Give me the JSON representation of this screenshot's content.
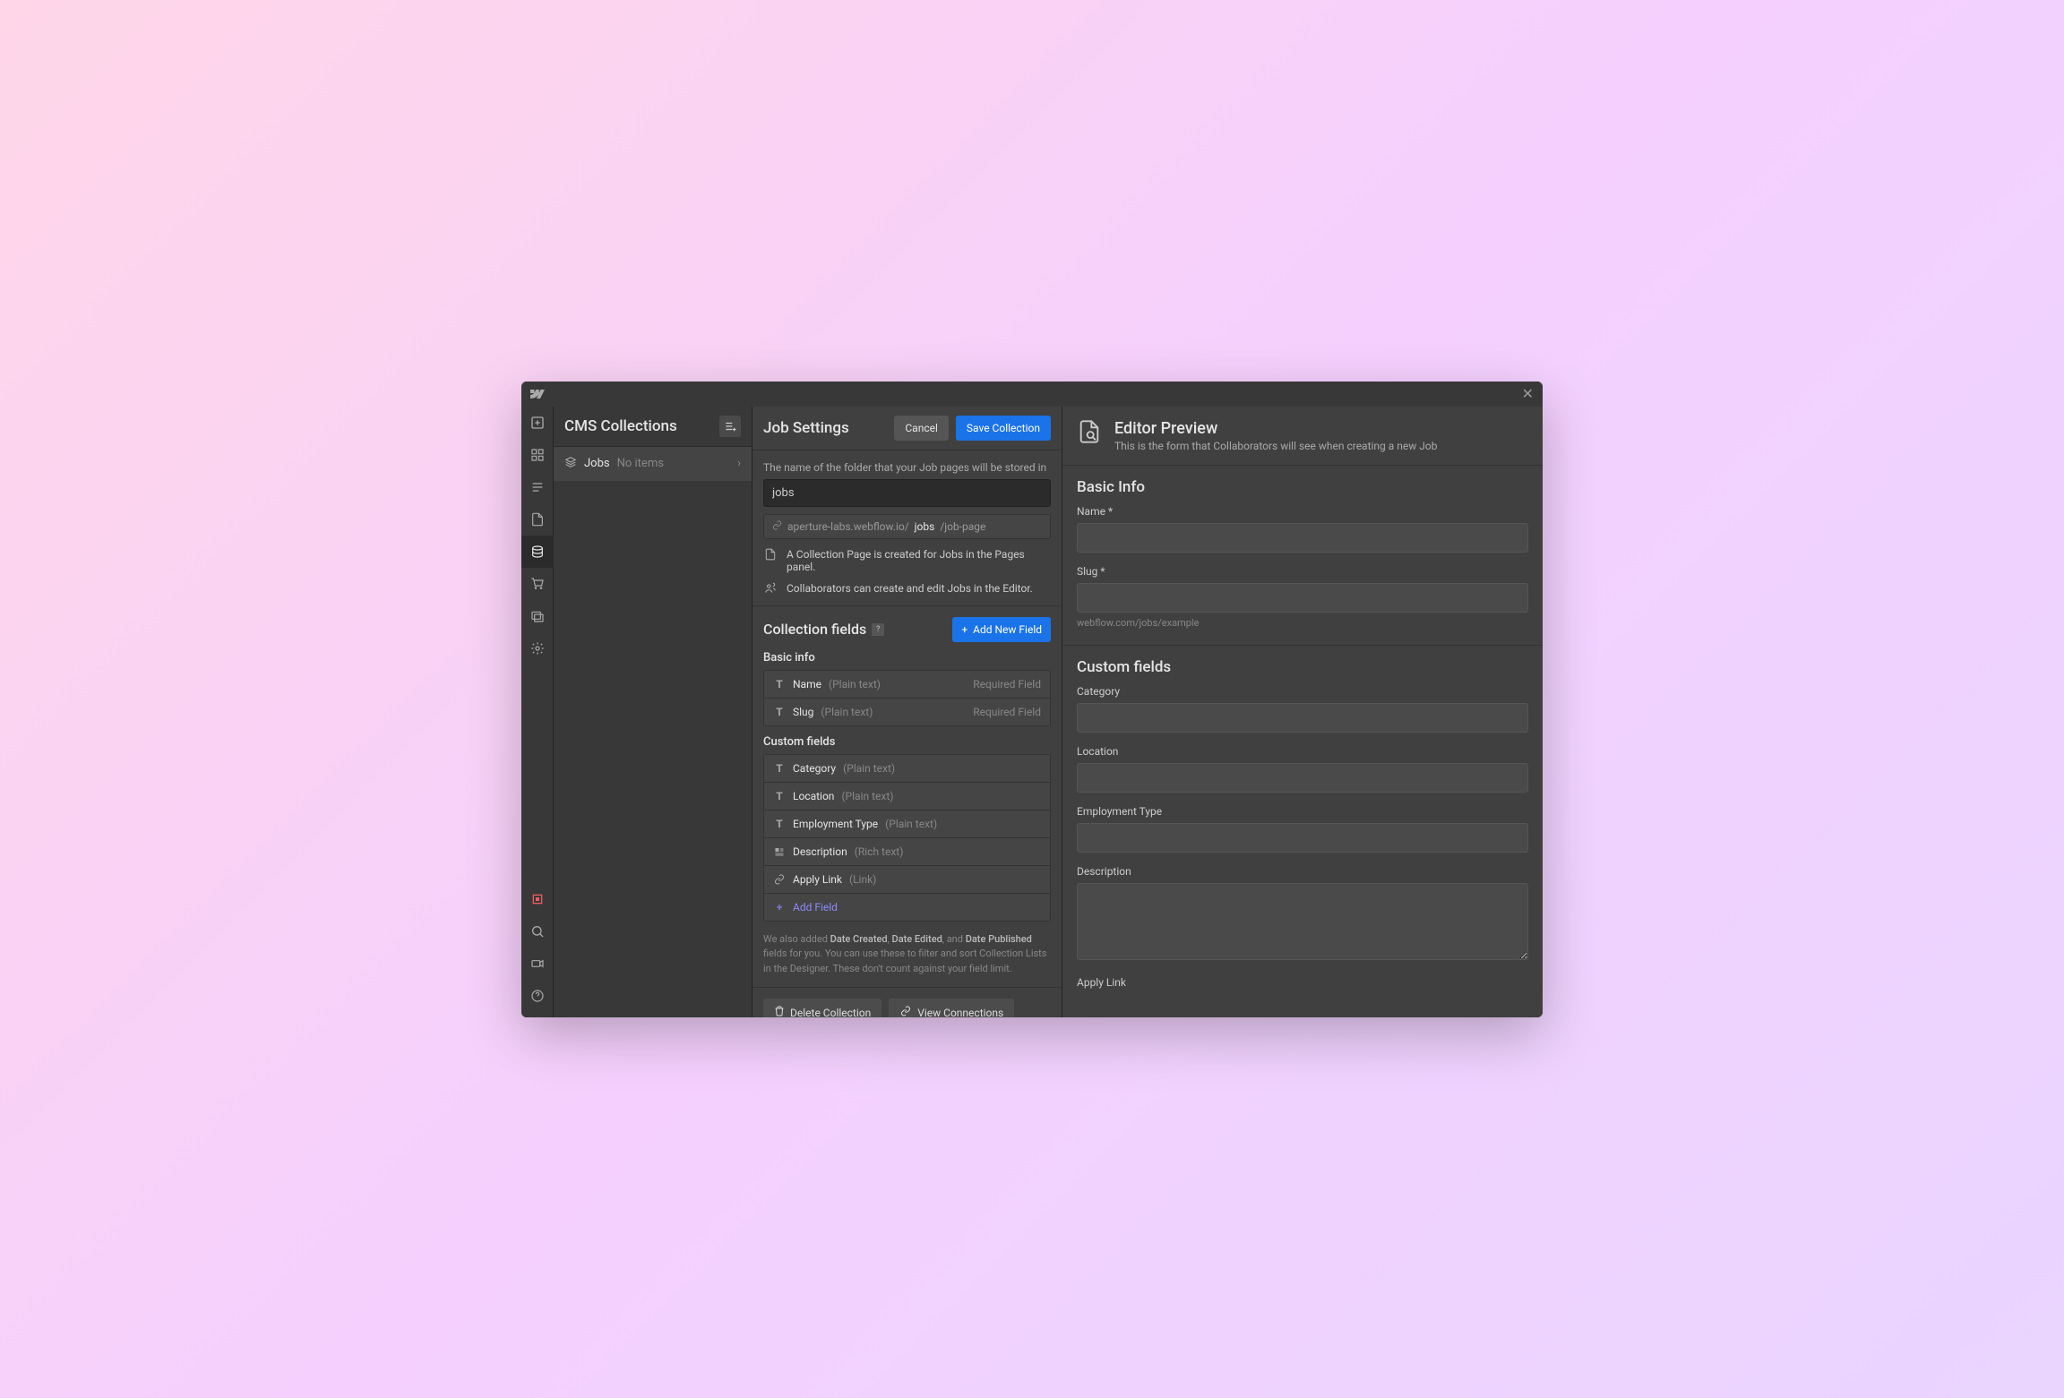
{
  "sidebar": {
    "title": "CMS Collections",
    "items": [
      {
        "name": "Jobs",
        "meta": "No items"
      }
    ]
  },
  "settings": {
    "title": "Job Settings",
    "cancel_label": "Cancel",
    "save_label": "Save Collection",
    "folder_label": "The name of the folder that your Job pages will be stored in",
    "slug_value": "jobs",
    "url_prefix": "aperture-labs.webflow.io/",
    "url_slug": "jobs",
    "url_suffix": "/job-page",
    "info1": "A Collection Page is created for Jobs in the Pages panel.",
    "info2": "Collaborators can create and edit Jobs in the Editor.",
    "collection_fields_title": "Collection fields",
    "add_new_field_label": "Add New Field",
    "basic_info_label": "Basic info",
    "basic_fields": [
      {
        "name": "Name",
        "type": "(Plain text)",
        "required": "Required Field"
      },
      {
        "name": "Slug",
        "type": "(Plain text)",
        "required": "Required Field"
      }
    ],
    "custom_fields_label": "Custom fields",
    "custom_fields": [
      {
        "name": "Category",
        "type": "(Plain text)",
        "icon": "T"
      },
      {
        "name": "Location",
        "type": "(Plain text)",
        "icon": "T"
      },
      {
        "name": "Employment Type",
        "type": "(Plain text)",
        "icon": "T"
      },
      {
        "name": "Description",
        "type": "(Rich text)",
        "icon": "rich"
      },
      {
        "name": "Apply Link",
        "type": "(Link)",
        "icon": "link"
      }
    ],
    "add_field_label": "Add Field",
    "footnote_pre": "We also added ",
    "footnote_1": "Date Created",
    "footnote_2": "Date Edited",
    "footnote_and": ", and ",
    "footnote_3": "Date Published",
    "footnote_post": " fields for you. You can use these to filter and sort Collection Lists in the Designer. These don't count against your field limit.",
    "delete_label": "Delete Collection",
    "view_conn_label": "View Connections"
  },
  "preview": {
    "title": "Editor Preview",
    "subtitle": "This is the form that Collaborators will see when creating a new Job",
    "basic_info_title": "Basic Info",
    "name_label": "Name *",
    "slug_label": "Slug *",
    "slug_hint": "webflow.com/jobs/example",
    "custom_fields_title": "Custom fields",
    "category_label": "Category",
    "location_label": "Location",
    "employment_label": "Employment Type",
    "description_label": "Description",
    "apply_label": "Apply Link"
  }
}
